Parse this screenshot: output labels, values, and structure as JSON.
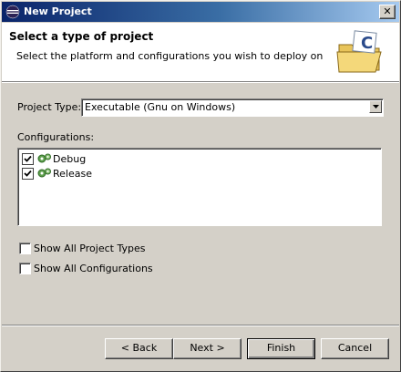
{
  "window": {
    "title": "New Project"
  },
  "header": {
    "title": "Select a type of project",
    "description": "Select the platform and configurations you wish to deploy on"
  },
  "project_type": {
    "label": "Project Type:",
    "value": "Executable (Gnu on Windows)"
  },
  "configurations": {
    "label": "Configurations:",
    "items": [
      {
        "label": "Debug",
        "checked": true
      },
      {
        "label": "Release",
        "checked": true
      }
    ]
  },
  "options": [
    {
      "label": "Show All Project Types",
      "checked": false
    },
    {
      "label": "Show All Configurations",
      "checked": false
    }
  ],
  "buttons": {
    "back": "< Back",
    "next": "Next >",
    "finish": "Finish",
    "cancel": "Cancel"
  },
  "colors": {
    "titlebar_start": "#0a246a",
    "titlebar_end": "#a6caf0",
    "dialog_bg": "#d4d0c8"
  }
}
